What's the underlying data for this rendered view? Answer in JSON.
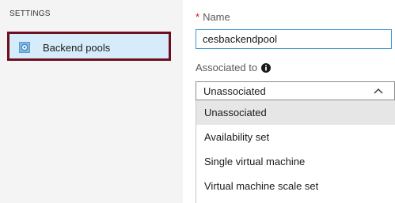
{
  "sidebar": {
    "header": "SETTINGS",
    "items": [
      {
        "label": "Backend pools",
        "icon": "backend-pool-icon",
        "selected": true
      }
    ]
  },
  "form": {
    "name": {
      "required_marker": "*",
      "label": "Name",
      "value": "cesbackendpool"
    },
    "associated_to": {
      "label": "Associated to",
      "info_icon": "info-icon",
      "selected_value": "Unassociated",
      "expanded": true,
      "options": [
        "Unassociated",
        "Availability set",
        "Single virtual machine",
        "Virtual machine scale set"
      ],
      "highlighted_option": "Unassociated"
    }
  },
  "colors": {
    "highlight_border": "#6e0f1f",
    "nav_selected_bg": "#d6ecfa",
    "input_focus_border": "#3c96d4",
    "required_star": "#e00b1c",
    "option_selected_bg": "#e6e6e6"
  }
}
